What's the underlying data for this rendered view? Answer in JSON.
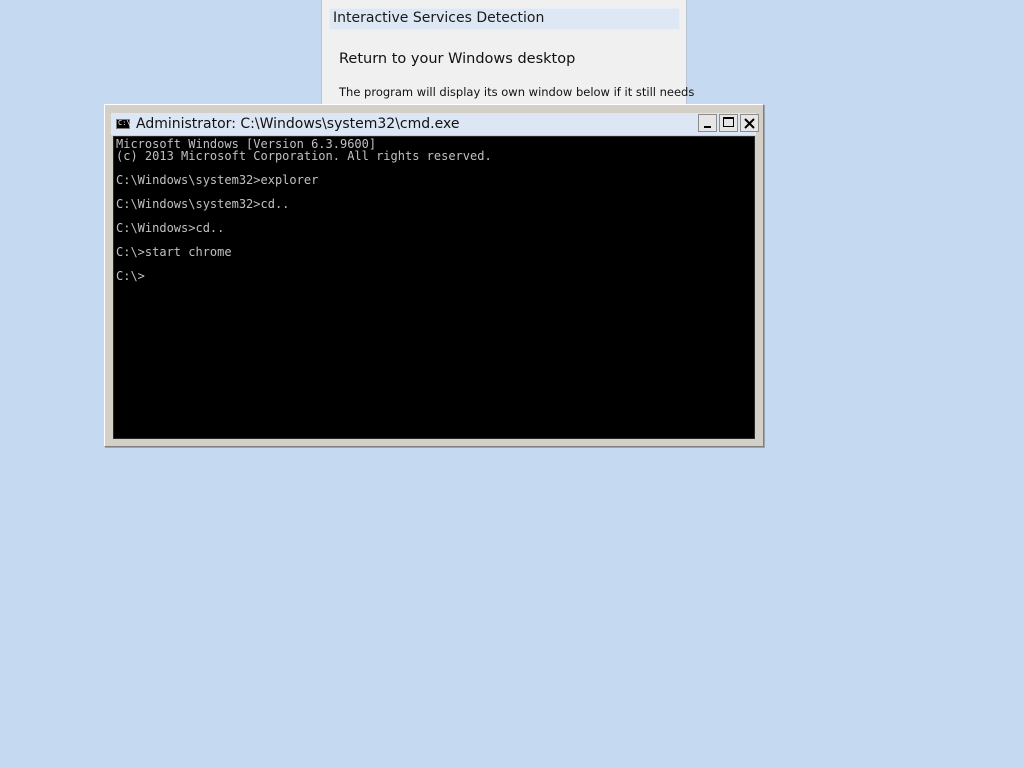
{
  "isd_dialog": {
    "title": "Interactive Services Detection",
    "heading": "Return to your Windows desktop",
    "body": "The program will display its own window below if it still needs"
  },
  "cmd_window": {
    "icon": "cmd-icon",
    "icon_glyph": "C:\\",
    "title": "Administrator: C:\\Windows\\system32\\cmd.exe",
    "controls": {
      "minimize": "minimize-icon",
      "maximize": "maximize-icon",
      "close": "close-icon"
    },
    "console_lines": [
      "Microsoft Windows [Version 6.3.9600]",
      "(c) 2013 Microsoft Corporation. All rights reserved.",
      "",
      "C:\\Windows\\system32>explorer",
      "",
      "C:\\Windows\\system32>cd..",
      "",
      "C:\\Windows>cd..",
      "",
      "C:\\>start chrome",
      "",
      "C:\\>"
    ]
  },
  "colors": {
    "desktop_bg": "#c5daf0",
    "console_bg": "#000000",
    "console_text": "#c0c0c0"
  }
}
